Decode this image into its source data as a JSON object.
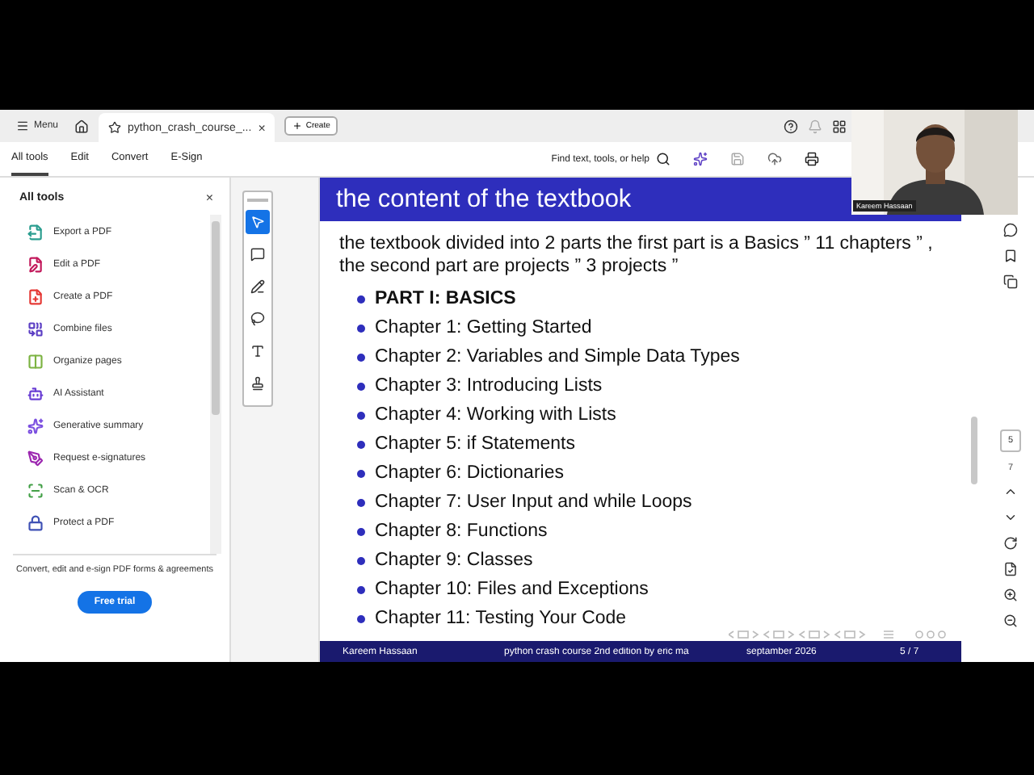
{
  "tab_bar": {
    "menu": "Menu",
    "document_tab": {
      "title": "python_crash_course_...",
      "close": "×"
    },
    "create": "Create"
  },
  "toolbar": {
    "tabs": [
      {
        "label": "All tools",
        "selected": true
      },
      {
        "label": "Edit",
        "selected": false
      },
      {
        "label": "Convert",
        "selected": false
      },
      {
        "label": "E-Sign",
        "selected": false
      }
    ],
    "search": "Find text, tools, or help"
  },
  "tools_panel": {
    "title": "All tools",
    "close": "×",
    "items": [
      {
        "label": "Export a PDF",
        "color": "#2a9d8f"
      },
      {
        "label": "Edit a PDF",
        "color": "#c2185b"
      },
      {
        "label": "Create a PDF",
        "color": "#e53935"
      },
      {
        "label": "Combine files",
        "color": "#5c3fc4"
      },
      {
        "label": "Organize pages",
        "color": "#7cb342"
      },
      {
        "label": "AI Assistant",
        "color": "#6a3fd4"
      },
      {
        "label": "Generative summary",
        "color": "#7b4fe0"
      },
      {
        "label": "Request e-signatures",
        "color": "#9c27b0"
      },
      {
        "label": "Scan & OCR",
        "color": "#43a047"
      },
      {
        "label": "Protect a PDF",
        "color": "#3f51b5"
      }
    ],
    "promo": "Convert, edit and e-sign PDF forms & agreements",
    "button": "Free trial"
  },
  "quick_tools": [
    {
      "selected": true
    },
    {
      "selected": false
    },
    {
      "selected": false
    },
    {
      "selected": false
    },
    {
      "selected": false
    },
    {
      "selected": false
    }
  ],
  "slide": {
    "title": "the content of the textbook",
    "intro": "the textbook divided into 2 parts the first part is a Basics ” 11 chapters ” , the second part are projects ” 3 projects ”",
    "bullets": [
      {
        "text": "PART I: BASICS",
        "bold": true
      },
      {
        "text": "Chapter 1: Getting Started",
        "bold": false
      },
      {
        "text": "Chapter 2: Variables and Simple Data Types",
        "bold": false
      },
      {
        "text": "Chapter 3: Introducing Lists",
        "bold": false
      },
      {
        "text": "Chapter 4: Working with Lists",
        "bold": false
      },
      {
        "text": "Chapter 5: if Statements",
        "bold": false
      },
      {
        "text": "Chapter 6: Dictionaries",
        "bold": false
      },
      {
        "text": "Chapter 7: User Input and while Loops",
        "bold": false
      },
      {
        "text": "Chapter 8: Functions",
        "bold": false
      },
      {
        "text": "Chapter 9: Classes",
        "bold": false
      },
      {
        "text": "Chapter 10: Files and Exceptions",
        "bold": false
      },
      {
        "text": "Chapter 11: Testing Your Code",
        "bold": false
      }
    ],
    "footer": [
      "Kareem Hassaan",
      "python crash course 2nd edition by eric ma",
      "septamber 2026",
      "5 / 7"
    ]
  },
  "page_nav": {
    "current": "5",
    "total": "7"
  },
  "webcam": {
    "kind": "picture",
    "name": "Kareem Hassaan"
  }
}
